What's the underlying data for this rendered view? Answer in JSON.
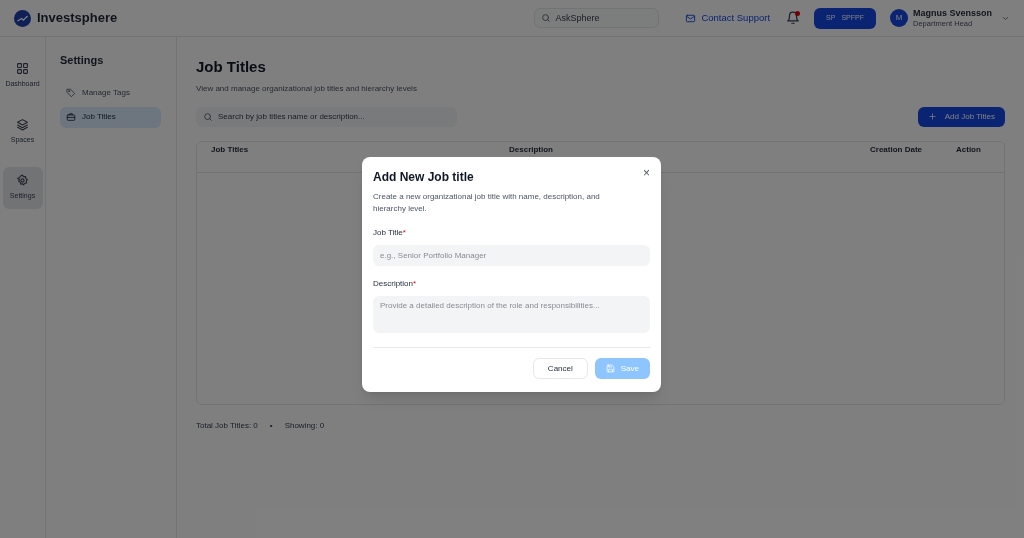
{
  "brand": {
    "name": "Investsphere"
  },
  "topbar": {
    "search_placeholder": "AskSphere",
    "contact": "Contact Support",
    "notification_dot": true,
    "workspace": {
      "initials": "SP",
      "name": "SPFPF"
    },
    "user": {
      "initial": "M",
      "name": "Magnus Svensson",
      "role": "Department Head"
    }
  },
  "rail": [
    {
      "label": "Dashboard",
      "kind": "grid",
      "selected": false
    },
    {
      "label": "Spaces",
      "kind": "layers",
      "selected": false
    },
    {
      "label": "Settings",
      "kind": "gear",
      "selected": true
    }
  ],
  "settings_menu": {
    "title": "Settings",
    "items": [
      {
        "label": "Manage Tags",
        "kind": "tag",
        "selected": false
      },
      {
        "label": "Job Titles",
        "kind": "briefcase",
        "selected": true
      }
    ]
  },
  "page": {
    "title": "Job Titles",
    "subtitle": "View and manage organizational job titles and hierarchy levels",
    "search_placeholder": "Search by job titles name or description...",
    "add_button": "Add Job Titles"
  },
  "table": {
    "columns": [
      "Job Titles",
      "Description",
      "Creation Date",
      "Action"
    ]
  },
  "footer": {
    "total": "Total Job Titles: 0",
    "separator": "•",
    "showing": "Showing: 0"
  },
  "dialog": {
    "title": "Add New Job title",
    "close": "×",
    "description": "Create a new organizational job title with name, description, and hierarchy level.",
    "fields": [
      {
        "label": "Job Title",
        "required": "*",
        "kind": "input",
        "placeholder": "e.g., Senior Portfolio Manager"
      },
      {
        "label": "Description",
        "required": "*",
        "kind": "textarea",
        "placeholder": "Provide a detailed description of the role and responsibilities..."
      }
    ],
    "cancel": "Cancel",
    "save": "Save",
    "save_disabled": true
  }
}
